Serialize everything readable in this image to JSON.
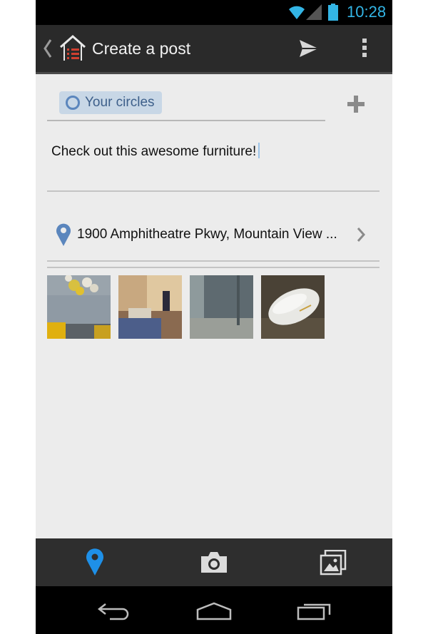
{
  "status_bar": {
    "time": "10:28",
    "accent_color": "#33b5e5",
    "icons": [
      "wifi-icon",
      "signal-icon",
      "battery-icon"
    ]
  },
  "action_bar": {
    "title": "Create a post",
    "icons": [
      "back-icon",
      "app-home-icon",
      "send-icon",
      "overflow-menu-icon"
    ]
  },
  "audience": {
    "chip_label": "Your circles",
    "add_icon": "plus-icon"
  },
  "post": {
    "text": "Check out this awesome furniture!"
  },
  "location": {
    "text": "1900 Amphitheatre Pkwy, Mountain View ...",
    "icon": "location-pin-icon"
  },
  "attachments": {
    "thumbnails": [
      "photo-1",
      "photo-2",
      "photo-3",
      "photo-4"
    ]
  },
  "toolbar": {
    "icons": [
      "location-pin-icon",
      "camera-icon",
      "gallery-icon"
    ],
    "active_color": "#1e90e8"
  },
  "nav_bar": {
    "icons": [
      "back-icon",
      "home-icon",
      "recent-apps-icon"
    ]
  }
}
